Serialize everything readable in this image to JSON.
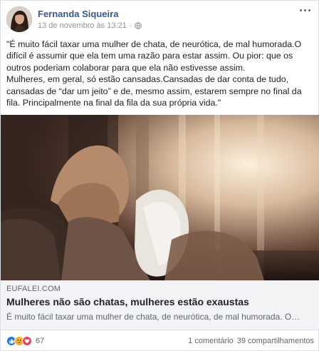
{
  "post": {
    "author": "Fernanda Siqueira",
    "timestamp": "13 de novembro às 13:21",
    "separator": "·",
    "privacy_icon": "globe-icon",
    "text_lines": [
      "\"É muito fácil taxar uma mulher de chata, de neurótica, de mal humorada.O difícil é assumir que ela tem uma razão para estar assim. Ou pior: que os outros poderiam colaborar para que ela não estivesse assim.",
      "Mulheres, em geral, só estão cansadas.Cansadas de dar conta de tudo, cansadas de “dar um jeito” e de, mesmo assim, estarem sempre no final da fila. Principalmente na final da fila da sua própria vida.\""
    ]
  },
  "link": {
    "domain": "EUFALEI.COM",
    "title": "Mulheres não são chatas, mulheres estão exaustas",
    "description": "É muito fácil taxar uma mulher de chata, de neurótica, de mal humorada. O…"
  },
  "footer": {
    "reaction_icons": [
      "like-icon",
      "sad-icon",
      "love-icon"
    ],
    "reaction_count": "67",
    "comments": "1 comentário",
    "shares": "39 compartilhamentos"
  },
  "colors": {
    "author_link": "#385898",
    "like": "#1877f2",
    "sad": "#f7b125",
    "love": "#f33e58",
    "link_bg": "#f2f3f5"
  }
}
